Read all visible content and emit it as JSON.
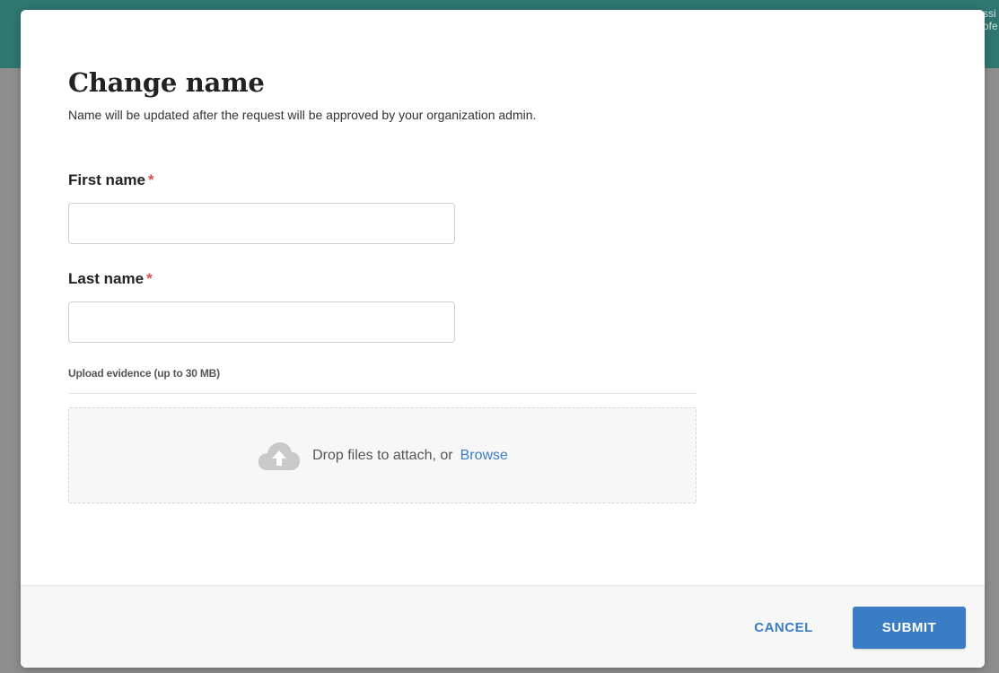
{
  "modal": {
    "title": "Change name",
    "subtitle": "Name will be updated after the request will be approved by your organization admin."
  },
  "fields": {
    "first_name": {
      "label": "First name",
      "required_mark": "*",
      "value": "",
      "placeholder": ""
    },
    "last_name": {
      "label": "Last name",
      "required_mark": "*",
      "value": "",
      "placeholder": ""
    }
  },
  "upload": {
    "label": "Upload evidence (up to 30 MB)",
    "drop_text": "Drop files to attach, or",
    "browse_label": "Browse",
    "icon": "cloud-upload-icon"
  },
  "footer": {
    "cancel_label": "CANCEL",
    "submit_label": "SUBMIT"
  },
  "colors": {
    "accent": "#3b7dc4",
    "required": "#d9534f",
    "header_bg": "#2f7770",
    "overlay": "#8e8e8e"
  }
}
